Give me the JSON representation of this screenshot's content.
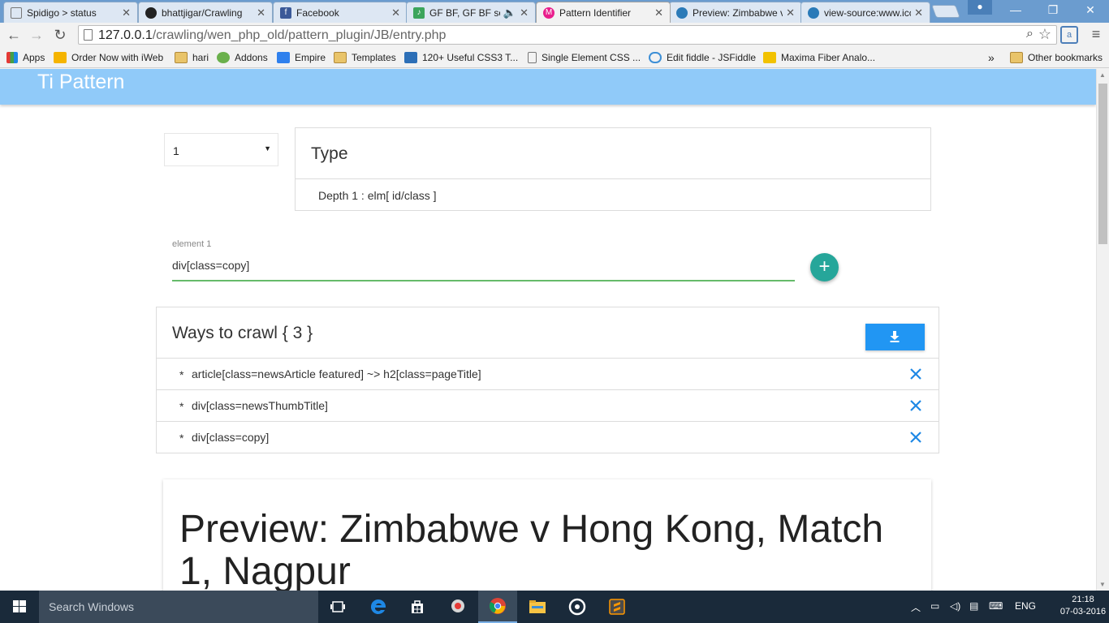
{
  "browser": {
    "tabs": [
      {
        "title": "Spidigo > status"
      },
      {
        "title": "bhattjigar/Crawling"
      },
      {
        "title": "Facebook"
      },
      {
        "title": "GF BF, GF BF song"
      },
      {
        "title": "Pattern Identifier"
      },
      {
        "title": "Preview: Zimbabwe v"
      },
      {
        "title": "view-source:www.icc"
      }
    ],
    "url_host": "127.0.0.1",
    "url_path": "/crawling/wen_php_old/pattern_plugin/JB/entry.php",
    "bookmarks": [
      {
        "label": "Apps"
      },
      {
        "label": "Order Now with iWeb"
      },
      {
        "label": "hari"
      },
      {
        "label": "Addons"
      },
      {
        "label": "Empire"
      },
      {
        "label": "Templates"
      },
      {
        "label": "120+ Useful CSS3 T..."
      },
      {
        "label": "Single Element CSS ..."
      },
      {
        "label": "Edit fiddle - JSFiddle"
      },
      {
        "label": "Maxima Fiber Analo..."
      }
    ],
    "bookmarks_overflow": "»",
    "other_bookmarks": "Other bookmarks"
  },
  "app": {
    "title": "Ti Pattern",
    "depth_select": {
      "value": "1"
    },
    "type_card": {
      "heading": "Type",
      "detail": "Depth 1 : elm[ id/class ]"
    },
    "element_field": {
      "label": "element 1",
      "value": "div[class=copy]"
    },
    "ways_card": {
      "heading": "Ways to crawl { 3 }",
      "items": [
        {
          "bullet": "*",
          "text": "article[class=newsArticle featured] ~> h2[class=pageTitle]"
        },
        {
          "bullet": "*",
          "text": "div[class=newsThumbTitle]"
        },
        {
          "bullet": "*",
          "text": "div[class=copy]"
        }
      ]
    },
    "preview": {
      "title": "Preview: Zimbabwe v Hong Kong, Match 1, Nagpur"
    }
  },
  "taskbar": {
    "search_placeholder": "Search Windows",
    "language": "ENG",
    "time": "21:18",
    "date": "07-03-2016"
  },
  "colors": {
    "appbar": "#90caf9",
    "fab": "#26a69a",
    "download_button": "#2196f3",
    "remove_icon": "#1e88e5",
    "field_underline": "#66bb6a"
  }
}
